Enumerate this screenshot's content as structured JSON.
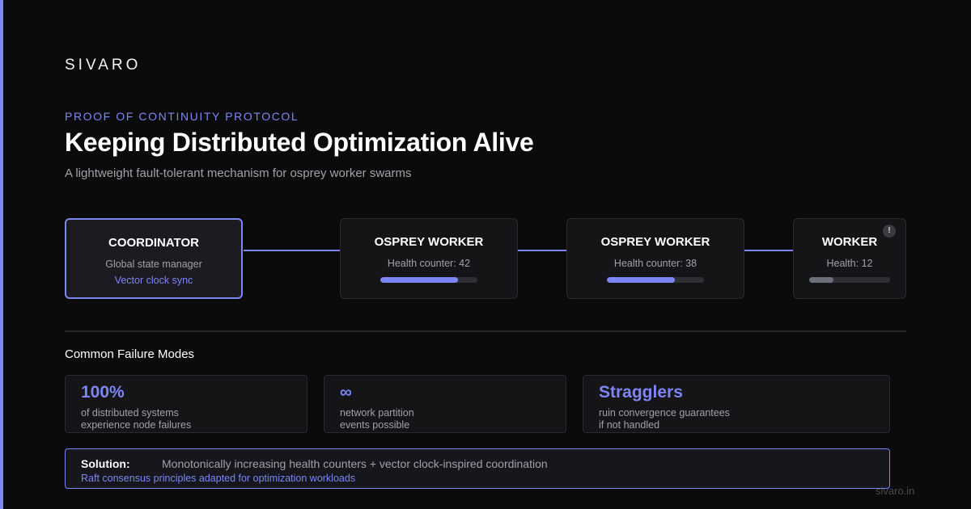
{
  "brand": "SIVARO",
  "eyebrow": "PROOF OF CONTINUITY PROTOCOL",
  "headline": "Keeping Distributed Optimization Alive",
  "subhead": "A lightweight fault-tolerant mechanism for osprey worker swarms",
  "colors": {
    "accent": "#7d86f5",
    "background": "#0b0b0c",
    "node_bg": "#151518",
    "muted_text": "#a1a1aa",
    "bar_degraded": "#6b6f7c"
  },
  "nodes": {
    "coordinator": {
      "title": "COORDINATOR",
      "subtitle": "Global state manager",
      "detail": "Vector clock sync"
    },
    "worker_1": {
      "title": "OSPREY WORKER",
      "subtitle": "Health counter: 42",
      "health_fraction": 0.8
    },
    "worker_2": {
      "title": "OSPREY WORKER",
      "subtitle": "Health counter: 38",
      "health_fraction": 0.7
    },
    "worker_3": {
      "title": "WORKER",
      "subtitle": "Health: 12",
      "health_fraction": 0.3,
      "alert": "!"
    }
  },
  "failure_modes": {
    "title": "Common Failure Modes",
    "cards": [
      {
        "stat": "100%",
        "line1": "of distributed systems",
        "line2": "experience node failures"
      },
      {
        "stat": "∞",
        "line1": "network partition",
        "line2": "events possible"
      },
      {
        "stat": "Stragglers",
        "line1": "ruin convergence guarantees",
        "line2": "if not handled"
      }
    ]
  },
  "solution": {
    "label": "Solution:",
    "text": "Monotonically increasing health counters + vector clock-inspired coordination",
    "note": "Raft consensus principles adapted for optimization workloads"
  },
  "footer_url": "sivaro.in"
}
